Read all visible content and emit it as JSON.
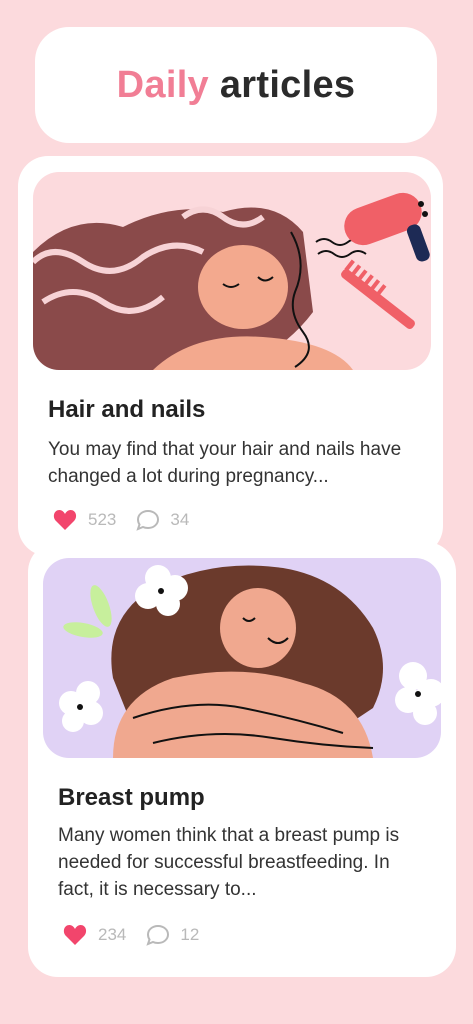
{
  "header": {
    "title_accent": "Daily",
    "title_main": "articles"
  },
  "articles": [
    {
      "title": "Hair and nails",
      "description": "You may find that your hair and nails have changed a lot during pregnancy...",
      "likes": "523",
      "comments": "34"
    },
    {
      "title": "Breast pump",
      "description": "Many women think that a breast pump is needed for successful breastfeeding. In fact, it is necessary to...",
      "likes": "234",
      "comments": "12"
    }
  ],
  "colors": {
    "background": "#fcdadd",
    "accent": "#f17e95",
    "heart": "#f2456c",
    "illus1_bg": "#fcdadd",
    "illus2_bg": "#e0d2f5"
  },
  "icons": {
    "like": "heart-icon",
    "comment": "comment-bubble-icon"
  }
}
